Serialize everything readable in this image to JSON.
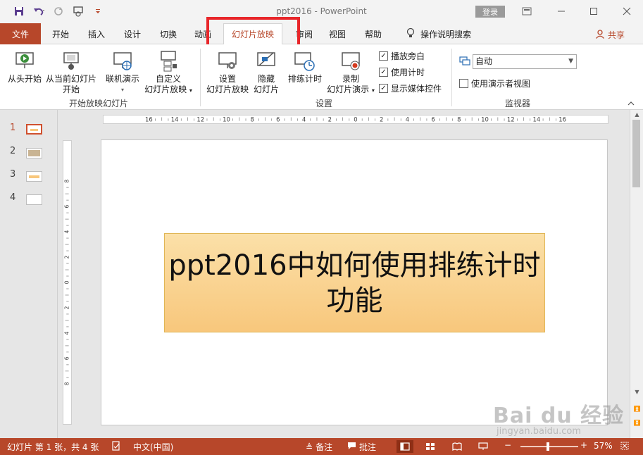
{
  "window": {
    "title": "ppt2016  -  PowerPoint",
    "login_label": "登录",
    "share_label": "共享"
  },
  "tabs": {
    "file": "文件",
    "home": "开始",
    "insert": "插入",
    "design": "设计",
    "transitions": "切换",
    "animations": "动画",
    "slideshow": "幻灯片放映",
    "review": "审阅",
    "view": "视图",
    "help": "帮助",
    "tell_me": "操作说明搜索"
  },
  "ribbon": {
    "start_group": {
      "label": "开始放映幻灯片",
      "from_beginning": "从头开始",
      "from_current_1": "从当前幻灯片",
      "from_current_2": "开始",
      "online_present": "联机演示",
      "custom_1": "自定义",
      "custom_2": "幻灯片放映"
    },
    "setup_group": {
      "label": "设置",
      "setup_1": "设置",
      "setup_2": "幻灯片放映",
      "hide_1": "隐藏",
      "hide_2": "幻灯片",
      "rehearse": "排练计时",
      "record_1": "录制",
      "record_2": "幻灯片演示",
      "play_narrations": "播放旁白",
      "use_timings": "使用计时",
      "show_media": "显示媒体控件"
    },
    "monitor_group": {
      "label": "监视器",
      "monitor_value": "自动",
      "presenter_view": "使用演示者视图"
    }
  },
  "thumbnails": [
    "1",
    "2",
    "3",
    "4"
  ],
  "ruler": {
    "h_ticks": [
      "16",
      "14",
      "12",
      "10",
      "8",
      "6",
      "4",
      "2",
      "0",
      "2",
      "4",
      "6",
      "8",
      "10",
      "12",
      "14",
      "16"
    ],
    "v_ticks": [
      "8",
      "6",
      "4",
      "2",
      "0",
      "2",
      "4",
      "6",
      "8"
    ]
  },
  "slide": {
    "title": "ppt2016中如何使用排练计时功能"
  },
  "status": {
    "slide_info": "幻灯片 第 1 张，共 4 张",
    "language": "中文(中国)",
    "notes": "备注",
    "comments": "批注",
    "zoom": "57%"
  },
  "watermark": {
    "brand": "Bai du 经验",
    "url": "jingyan.baidu.com"
  },
  "colors": {
    "accent": "#b7472a",
    "highlight": "#e8262a",
    "title_fill": "#f9cf86"
  }
}
